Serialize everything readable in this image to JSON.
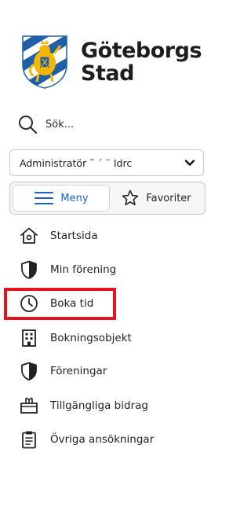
{
  "brand": {
    "name_line1": "Göteborgs",
    "name_line2": "Stad"
  },
  "search": {
    "placeholder": "Sök..."
  },
  "organization_select": {
    "value": "Administratör ˜   ´ ¨   Idrc"
  },
  "tabs": {
    "menu_label": "Meny",
    "favorites_label": "Favoriter",
    "active": "Meny"
  },
  "nav": {
    "items": [
      {
        "label": "Startsida",
        "icon": "home-icon"
      },
      {
        "label": "Min förening",
        "icon": "shield-icon"
      },
      {
        "label": "Boka tid",
        "icon": "clock-icon"
      },
      {
        "label": "Bokningsobjekt",
        "icon": "building-icon"
      },
      {
        "label": "Föreningar",
        "icon": "shield-icon"
      },
      {
        "label": "Tillgängliga bidrag",
        "icon": "gift-icon"
      },
      {
        "label": "Övriga ansökningar",
        "icon": "clipboard-icon"
      }
    ]
  },
  "colors": {
    "accent": "#1b5fbf",
    "highlight": "#e3141e",
    "crest_blue": "#1f5fa8",
    "crest_gold": "#f2b705"
  }
}
